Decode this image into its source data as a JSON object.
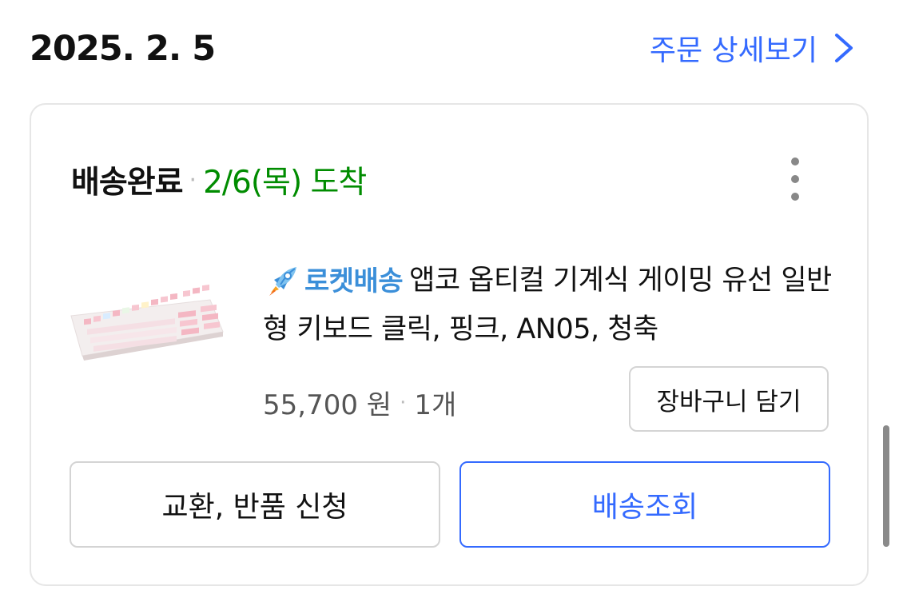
{
  "header": {
    "order_date": "2025. 2. 5",
    "detail_link_label": "주문 상세보기"
  },
  "card": {
    "status_label": "배송완료",
    "status_separator": "·",
    "arrival_text": "2/6(목) 도착",
    "product": {
      "badge_label": "로켓배송",
      "title": "앱코 옵티컬 기계식 게이밍 유선 일반형 키보드 클릭, 핑크, AN05, 청축",
      "price": "55,700 원",
      "separator": "·",
      "quantity": "1개"
    },
    "cart_button_label": "장바구니 담기",
    "exchange_button_label": "교환, 반품 신청",
    "tracking_button_label": "배송조회"
  },
  "colors": {
    "link_blue": "#346aff",
    "arrival_green": "#008c00",
    "rocket_blue": "#3b8fd9"
  },
  "icons": {
    "chevron": "chevron-right-icon",
    "more": "more-vertical-icon",
    "rocket": "rocket-icon"
  }
}
